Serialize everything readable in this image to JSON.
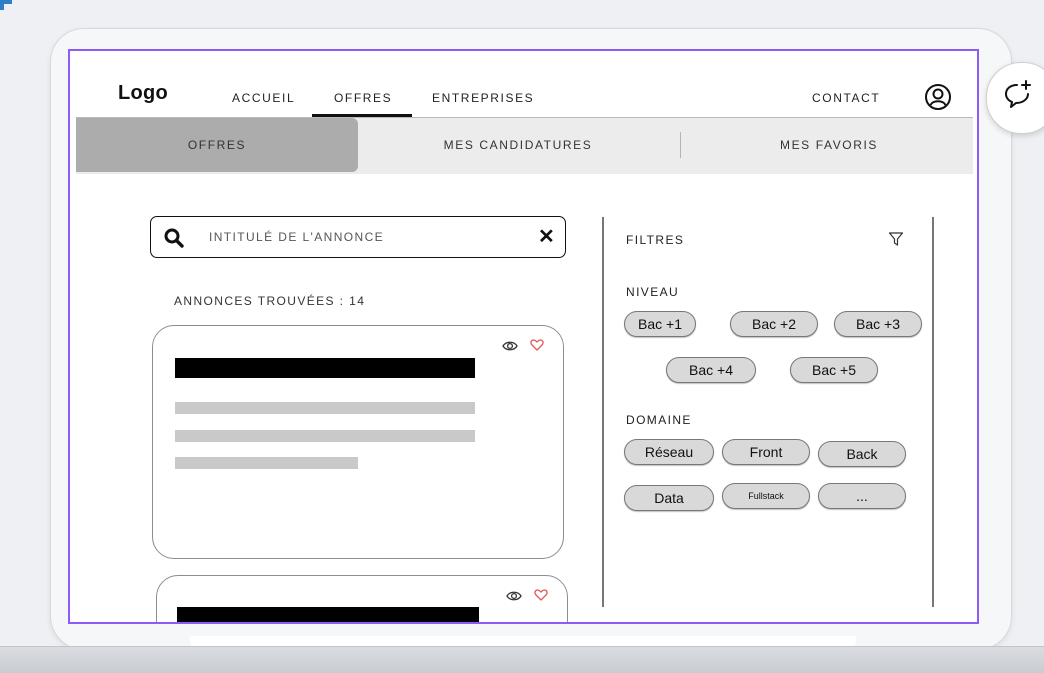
{
  "nav": {
    "logo": "Logo",
    "items": [
      "ACCUEIL",
      "OFFRES",
      "ENTREPRISES"
    ],
    "contact": "CONTACT",
    "active": "OFFRES"
  },
  "tabs": [
    "OFFRES",
    "MES CANDIDATURES",
    "MES FAVORIS"
  ],
  "search": {
    "placeholder": "INTITULÉ DE L'ANNONCE",
    "value": ""
  },
  "results_label": "ANNONCES TROUVÉES : 14",
  "filters": {
    "title": "FILTRES",
    "niveau": {
      "label": "NIVEAU",
      "chips": [
        "Bac +1",
        "Bac +2",
        "Bac +3",
        "Bac +4",
        "Bac +5"
      ]
    },
    "domaine": {
      "label": "DOMAINE",
      "chips": [
        "Réseau",
        "Front",
        "Back",
        "Data",
        "Fullstack",
        "..."
      ]
    }
  },
  "colors": {
    "frame_accent": "#8b5cf6",
    "active_tab": "#acacac",
    "heart": "#e05a5a",
    "chip_bg": "#d9d9d9"
  },
  "icons": [
    "account-icon",
    "search-icon",
    "clear-icon",
    "eye-icon",
    "heart-icon",
    "filter-icon",
    "comment-add-icon"
  ]
}
